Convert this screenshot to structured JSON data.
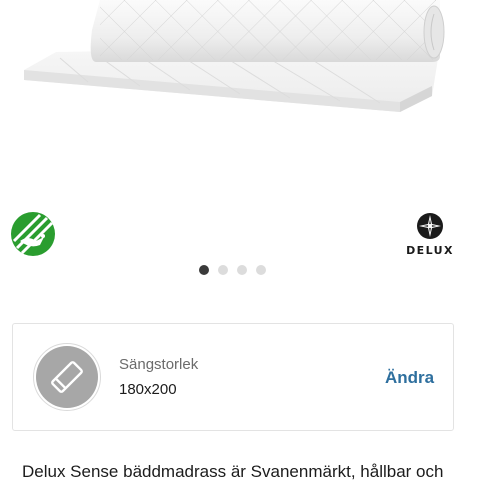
{
  "product": {
    "image_icon": "mattress-topper-image",
    "certification_logo": "svanen-ecolabel-icon",
    "brand_logo": {
      "icon": "delux-star-icon",
      "text": "DELUX"
    },
    "carousel": {
      "total_slides": 4,
      "active_index": 0
    }
  },
  "size_selector": {
    "icon": "bed-size-icon",
    "label": "Sängstorlek",
    "value": "180x200",
    "change_label": "Ändra"
  },
  "description": {
    "text": "Delux Sense bäddmadrass är Svanenmärkt, hållbar och"
  },
  "colors": {
    "accent": "#2e6f9e",
    "svanen_green": "#2a9d2f",
    "dot_active": "#3a3a3a",
    "dot_inactive": "#dcdcdc"
  }
}
